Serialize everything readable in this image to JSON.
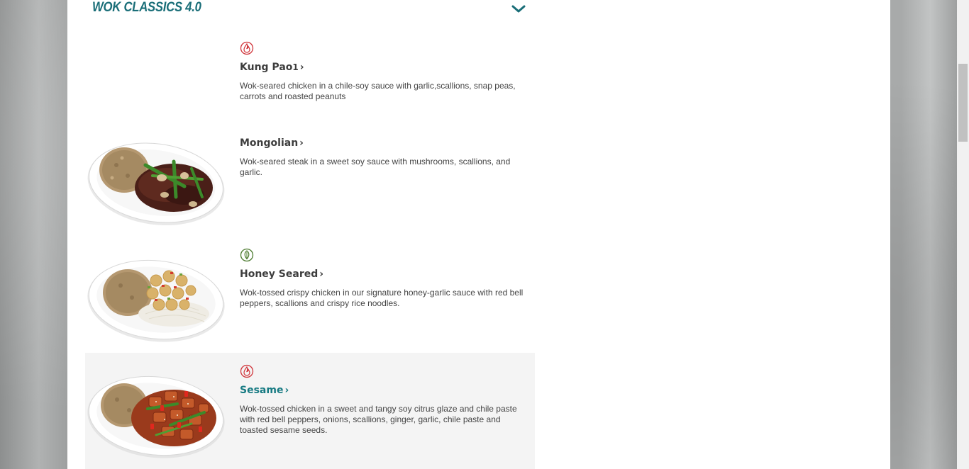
{
  "section": {
    "title": "WOK CLASSICS 4.0"
  },
  "items": [
    {
      "name": "Kung Pao",
      "superscript": "1",
      "description": "Wok-seared chicken in a chile-soy sauce with garlic,scallions, snap peas, carrots and roasted peanuts",
      "icon": "spicy-icon",
      "has_image": false
    },
    {
      "name": "Mongolian",
      "description": "Wok-seared steak in a sweet soy sauce with mushrooms, scallions, and garlic.",
      "has_image": true
    },
    {
      "name": "Honey Seared",
      "description": "Wok-tossed crispy chicken in our signature honey-garlic sauce with red bell peppers, scallions and crispy rice noodles.",
      "icon": "leaf-icon",
      "has_image": true
    },
    {
      "name": "Sesame",
      "description": "Wok-tossed chicken in a sweet and tangy soy citrus glaze and chile paste with red bell peppers, onions, scallions, ginger, garlic, chile paste and toasted sesame seeds.",
      "icon": "spicy-icon",
      "has_image": true
    }
  ],
  "colors": {
    "accent": "#167a82",
    "spicy": "#d0343a",
    "leaf": "#4b7a2e"
  }
}
